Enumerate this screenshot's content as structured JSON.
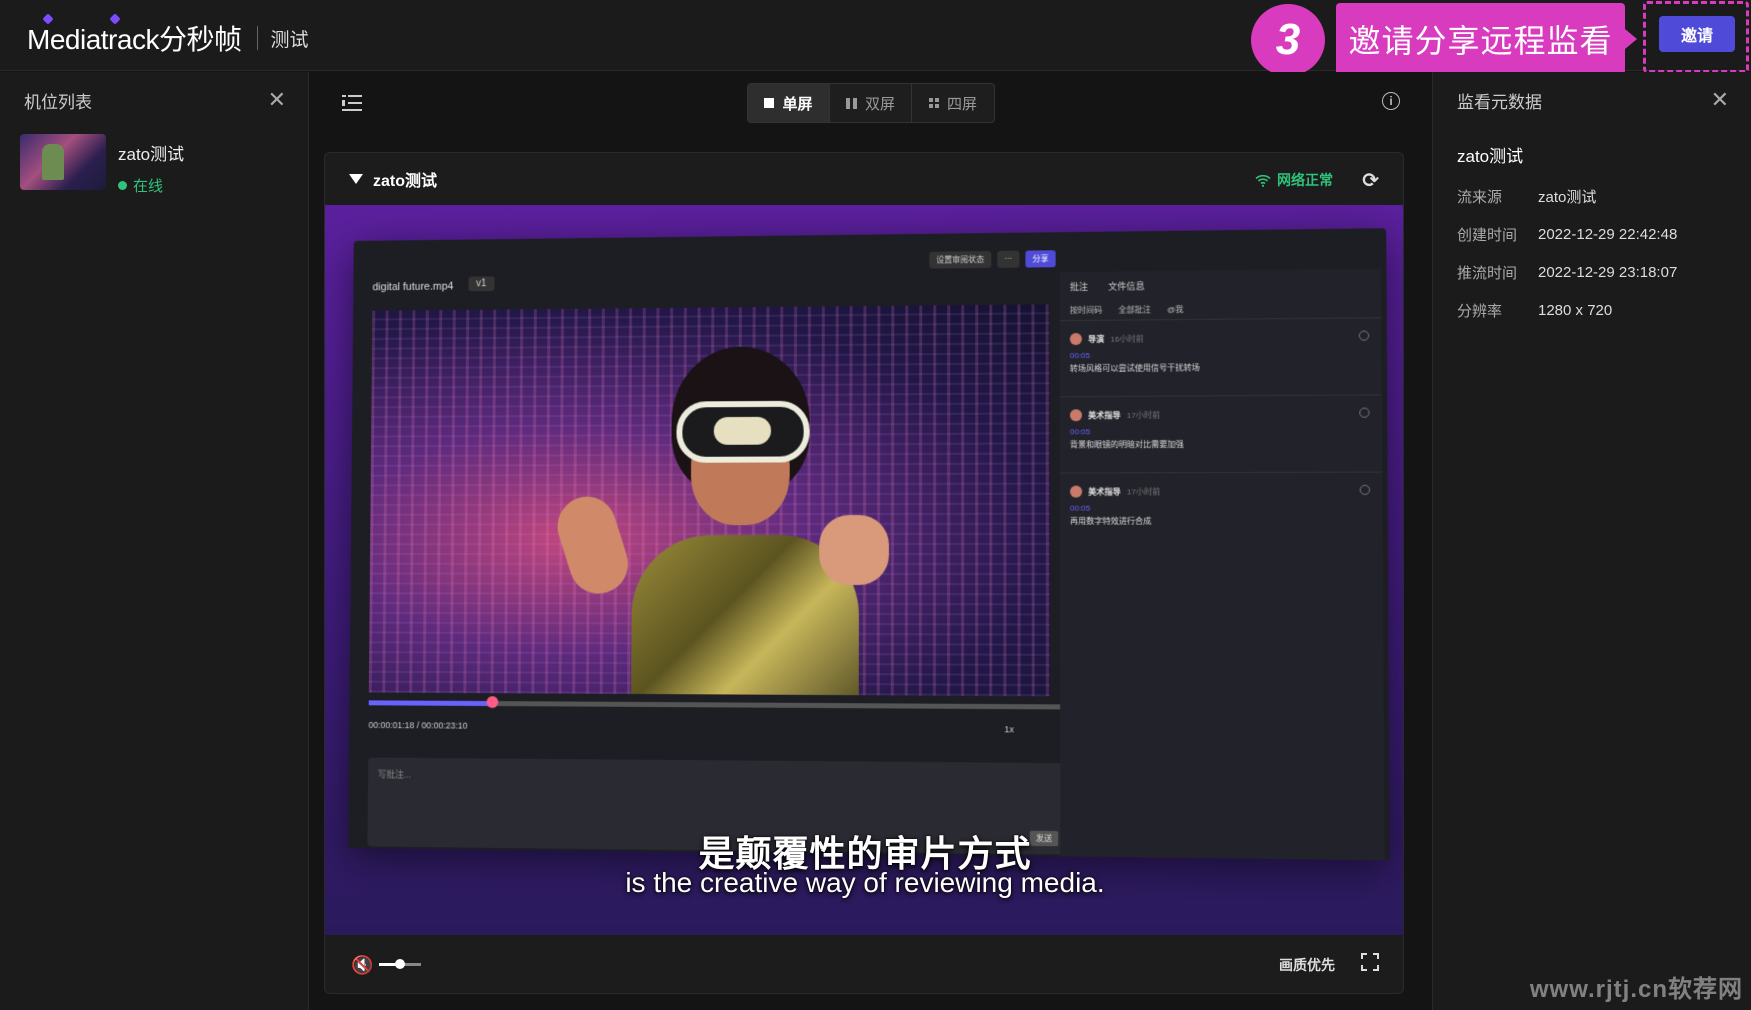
{
  "header": {
    "logo": "Mediatrack分秒帧",
    "project": "测试",
    "step_number": "3",
    "step_text": "邀请分享远程监看",
    "invite_label": "邀请"
  },
  "left_panel": {
    "title": "机位列表",
    "cameras": [
      {
        "name": "zato测试",
        "status": "在线"
      }
    ]
  },
  "toolbar": {
    "modes": [
      {
        "label": "单屏",
        "active": true
      },
      {
        "label": "双屏",
        "active": false
      },
      {
        "label": "四屏",
        "active": false
      }
    ],
    "info_icon": "i"
  },
  "player": {
    "title": "zato测试",
    "network": "网络正常",
    "quality": "画质优先",
    "volume": 0.5,
    "inner_app": {
      "file": "digital future.mp4",
      "version": "v1",
      "status_btn": "设置审阅状态",
      "more_btn": "···",
      "share_btn": "分享",
      "tab_comments": "批注",
      "tab_info": "文件信息",
      "filter_sort": "按时间码",
      "filter_all": "全部批注",
      "filter_me": "@我",
      "notes": [
        {
          "who": "导演",
          "time": "16小时前",
          "tc": "00:05",
          "text": "转场风格可以尝试使用信号干扰转场"
        },
        {
          "who": "美术指导",
          "time": "17小时前",
          "tc": "00:05",
          "text": "背景和眼镜的明暗对比需要加强"
        },
        {
          "who": "美术指导",
          "time": "17小时前",
          "tc": "00:05",
          "text": "再用数字特效进行合成"
        }
      ],
      "timecode": "00:00:01:18 / 00:00:23:10",
      "speed": "1x",
      "comment_placeholder": "写批注...",
      "send": "发送"
    },
    "subtitle_cn": "是颠覆性的审片方式",
    "subtitle_en": "is the creative way of reviewing media."
  },
  "right_panel": {
    "title": "监看元数据",
    "stream_name": "zato测试",
    "rows": [
      {
        "key": "流来源",
        "value": "zato测试"
      },
      {
        "key": "创建时间",
        "value": "2022-12-29 22:42:48"
      },
      {
        "key": "推流时间",
        "value": "2022-12-29 23:18:07"
      },
      {
        "key": "分辨率",
        "value": "1280 x 720"
      }
    ]
  },
  "watermark": "www.rjtj.cn软荐网",
  "colors": {
    "accent": "#4f4bd8",
    "highlight": "#d93bbf",
    "online": "#2fc27a"
  }
}
